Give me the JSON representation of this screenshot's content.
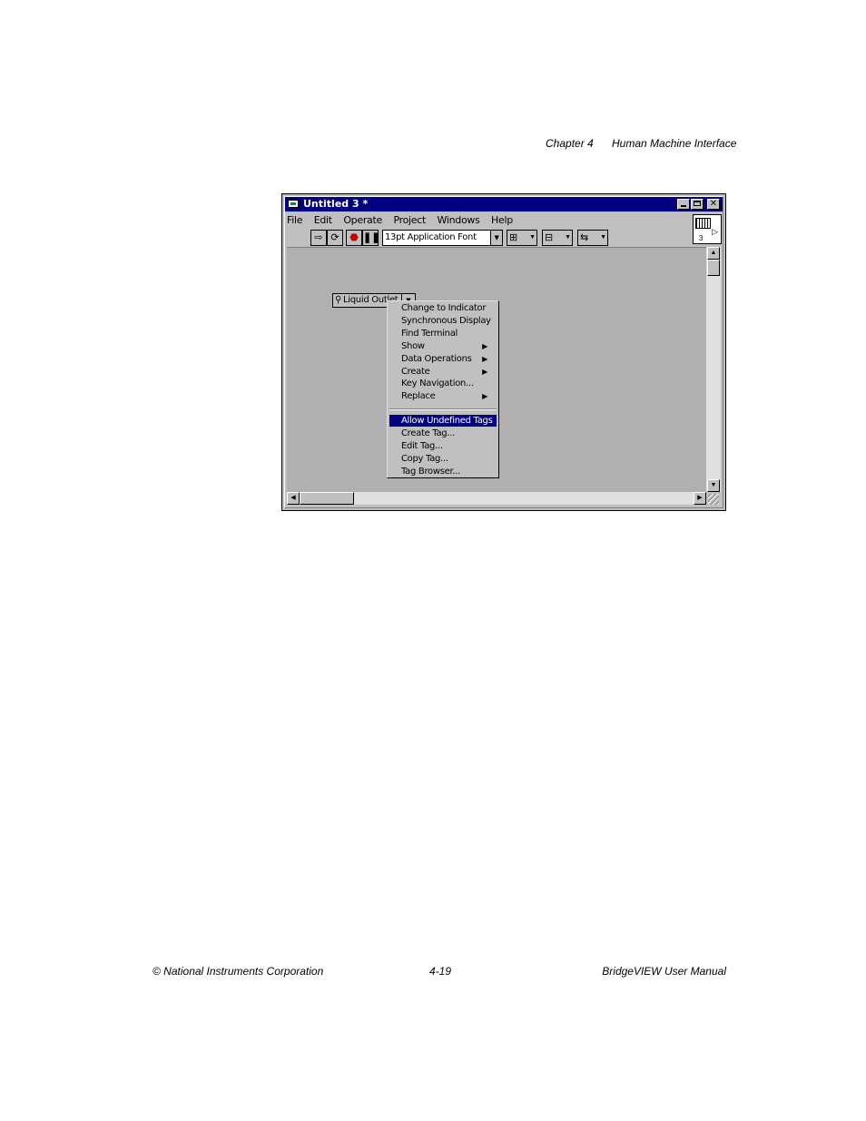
{
  "header": {
    "chapter": "Chapter 4",
    "section": "Human Machine Interface"
  },
  "footer": {
    "left": "© National Instruments Corporation",
    "center": "4-19",
    "right": "BridgeVIEW User Manual"
  },
  "window": {
    "title": "Untitled 3 *",
    "menu": [
      "File",
      "Edit",
      "Operate",
      "Project",
      "Windows",
      "Help"
    ],
    "font_select": "13pt Application Font",
    "icon_number": "3"
  },
  "control": {
    "label": "Liquid Outlet"
  },
  "context_menu": {
    "items": [
      {
        "label": "Change to Indicator",
        "submenu": false
      },
      {
        "label": "Synchronous Display",
        "submenu": false
      },
      {
        "label": "Find Terminal",
        "submenu": false
      },
      {
        "label": "Show",
        "submenu": true
      },
      {
        "label": "Data Operations",
        "submenu": true
      },
      {
        "label": "Create",
        "submenu": true
      },
      {
        "label": "Key Navigation...",
        "submenu": false
      },
      {
        "label": "Replace",
        "submenu": true
      }
    ],
    "tag_items": [
      {
        "label": "Allow Undefined Tags",
        "selected": true
      },
      {
        "label": "Create Tag...",
        "selected": false
      },
      {
        "label": "Edit Tag...",
        "selected": false
      },
      {
        "label": "Copy Tag...",
        "selected": false
      },
      {
        "label": "Tag Browser...",
        "selected": false
      }
    ]
  }
}
